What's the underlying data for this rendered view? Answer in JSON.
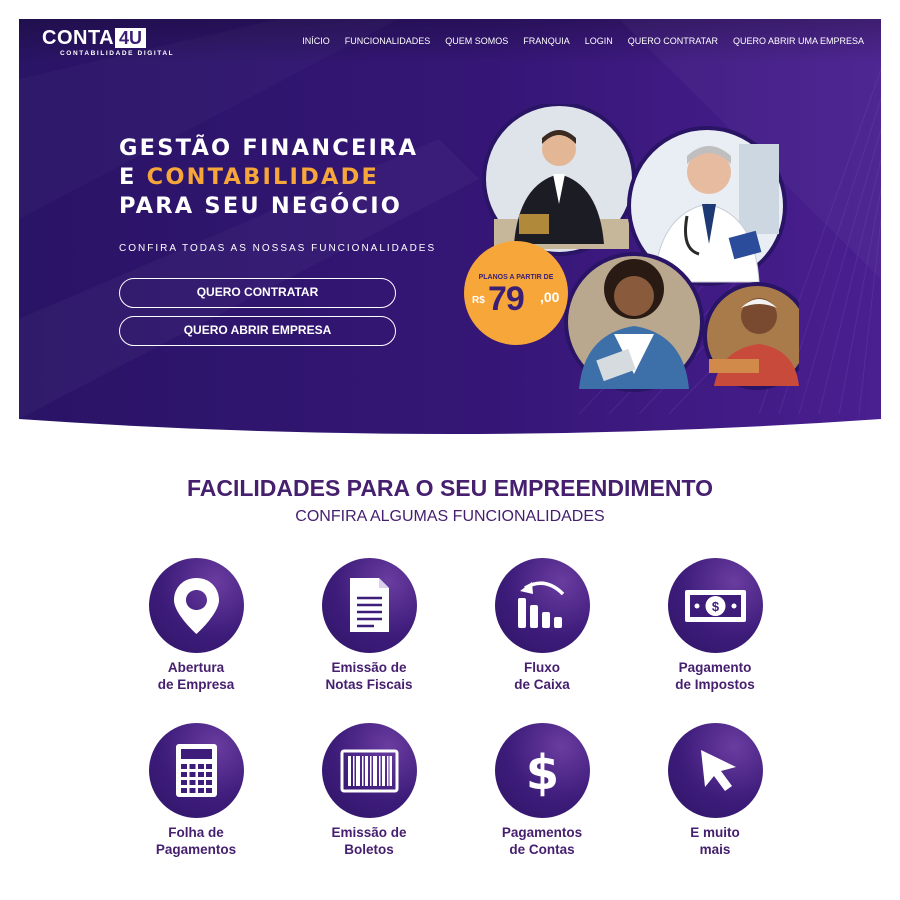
{
  "brand": {
    "logo_main": "CONTA",
    "logo_accent": "4U",
    "logo_sub": "CONTABILIDADE DIGITAL"
  },
  "nav": {
    "items": [
      "INÍCIO",
      "FUNCIONALIDADES",
      "QUEM SOMOS",
      "FRANQUIA",
      "LOGIN",
      "QUERO CONTRATAR",
      "QUERO ABRIR UMA EMPRESA"
    ]
  },
  "hero": {
    "line1": "GESTÃO FINANCEIRA",
    "line2_prefix": "E ",
    "line2_accent": "CONTABILIDADE",
    "line3": "PARA SEU NEGÓCIO",
    "subtitle": "CONFIRA TODAS AS NOSSAS FUNCIONALIDADES",
    "button_contratar": "QUERO CONTRATAR",
    "button_abrir": "QUERO ABRIR EMPRESA"
  },
  "price_badge": {
    "label": "PLANOS A PARTIR DE",
    "currency": "R$",
    "amount": "79",
    "cents": ",00"
  },
  "features": {
    "title": "FACILIDADES PARA O SEU EMPREENDIMENTO",
    "subtitle": "CONFIRA ALGUMAS FUNCIONALIDADES",
    "items": [
      {
        "line1": "Abertura",
        "line2": "de Empresa",
        "icon": "location-pin-icon"
      },
      {
        "line1": "Emissão de",
        "line2": "Notas Fiscais",
        "icon": "document-icon"
      },
      {
        "line1": "Fluxo",
        "line2": "de Caixa",
        "icon": "growth-chart-icon"
      },
      {
        "line1": "Pagamento",
        "line2": "de Impostos",
        "icon": "banknote-icon"
      },
      {
        "line1": "Folha de",
        "line2": "Pagamentos",
        "icon": "calculator-icon"
      },
      {
        "line1": "Emissão de",
        "line2": "Boletos",
        "icon": "barcode-icon"
      },
      {
        "line1": "Pagamentos",
        "line2": "de Contas",
        "icon": "dollar-sign-icon"
      },
      {
        "line1": "E muito",
        "line2": "mais",
        "icon": "cursor-arrow-icon"
      }
    ]
  },
  "colors": {
    "hero_dark": "#2a1060",
    "hero_purple": "#4a1f8a",
    "accent_orange": "#f7a63a",
    "text_purple": "#46206f"
  }
}
